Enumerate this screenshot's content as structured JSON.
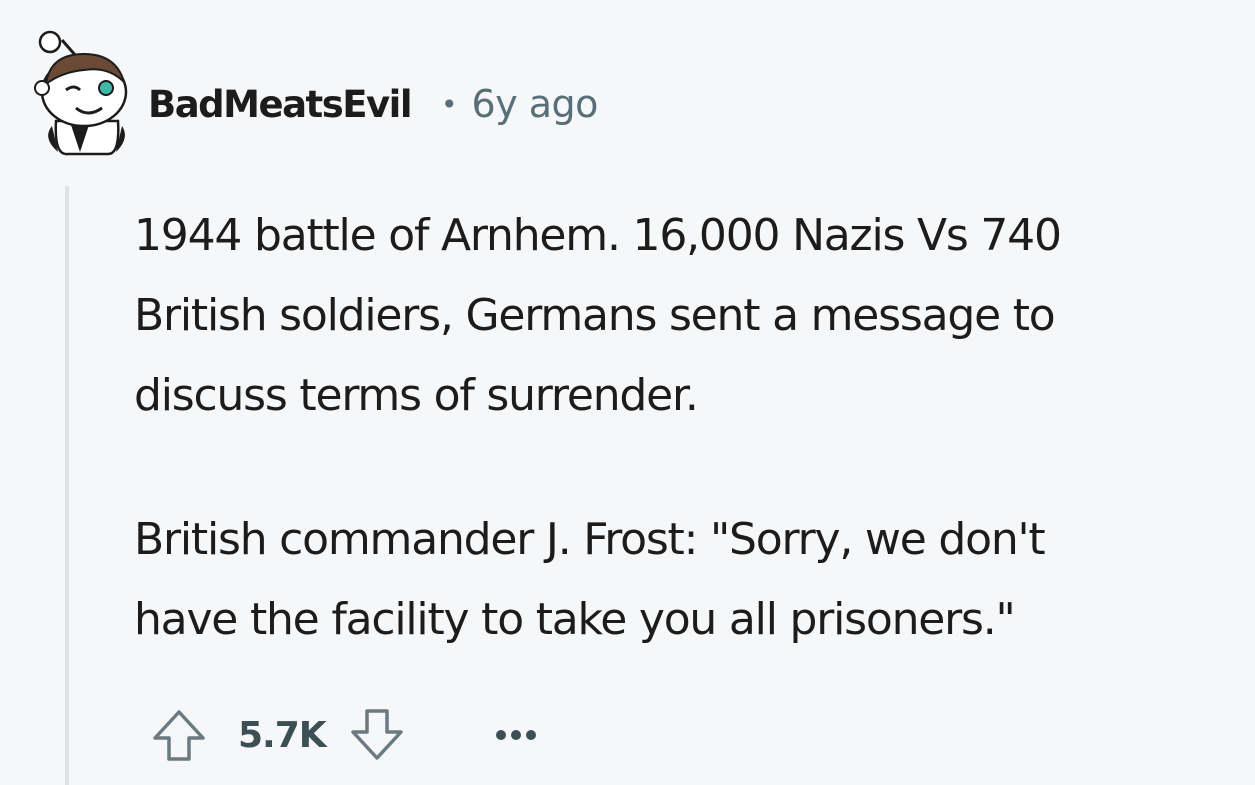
{
  "comment": {
    "author": "BadMeatsEvil",
    "separator": "•",
    "timestamp": "6y ago",
    "paragraphs": [
      "1944 battle of Arnhem. 16,000 Nazis Vs 740\nBritish soldiers, Germans sent a message to\ndiscuss terms of surrender.",
      "British commander J. Frost: \"Sorry, we don't\nhave the facility to take you all prisoners.\""
    ],
    "score": "5.7K"
  },
  "icons": {
    "avatar": "snoo-avatar-icon",
    "upvote": "upvote-arrow-icon",
    "downvote": "downvote-arrow-icon",
    "more": "more-options-icon"
  },
  "colors": {
    "background": "#f6f7f8",
    "text": "#1c1c1c",
    "meta": "#576f76",
    "thread_line": "#dfe3e6"
  }
}
